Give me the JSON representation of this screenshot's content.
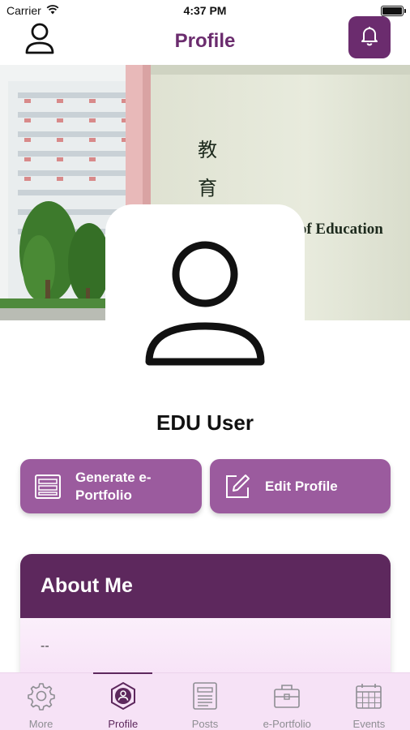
{
  "status_bar": {
    "carrier": "Carrier",
    "time": "4:37 PM",
    "wifi_icon": "wifi-icon",
    "battery_icon": "battery-icon"
  },
  "header": {
    "title": "Profile",
    "left_icon": "user-icon",
    "right_icon": "bell-icon"
  },
  "cover": {
    "sign_chars": [
      "教",
      "育"
    ],
    "sign_text": "lty of Education"
  },
  "profile": {
    "name": "EDU User",
    "avatar_icon": "user-avatar-icon"
  },
  "actions": {
    "generate_label": "Generate e-Portfolio",
    "generate_icon": "document-icon",
    "edit_label": "Edit Profile",
    "edit_icon": "edit-icon"
  },
  "about": {
    "title": "About Me",
    "content": "--"
  },
  "tabs": [
    {
      "label": "More",
      "icon": "gear-icon",
      "active": false
    },
    {
      "label": "Profile",
      "icon": "profile-badge-icon",
      "active": true
    },
    {
      "label": "Posts",
      "icon": "posts-icon",
      "active": false
    },
    {
      "label": "e-Portfolio",
      "icon": "briefcase-icon",
      "active": false
    },
    {
      "label": "Events",
      "icon": "calendar-icon",
      "active": false
    }
  ],
  "colors": {
    "primary": "#6b2c6e",
    "button": "#9b5b9e",
    "card_header": "#5d285d",
    "tab_bar": "#f6e2f6"
  }
}
